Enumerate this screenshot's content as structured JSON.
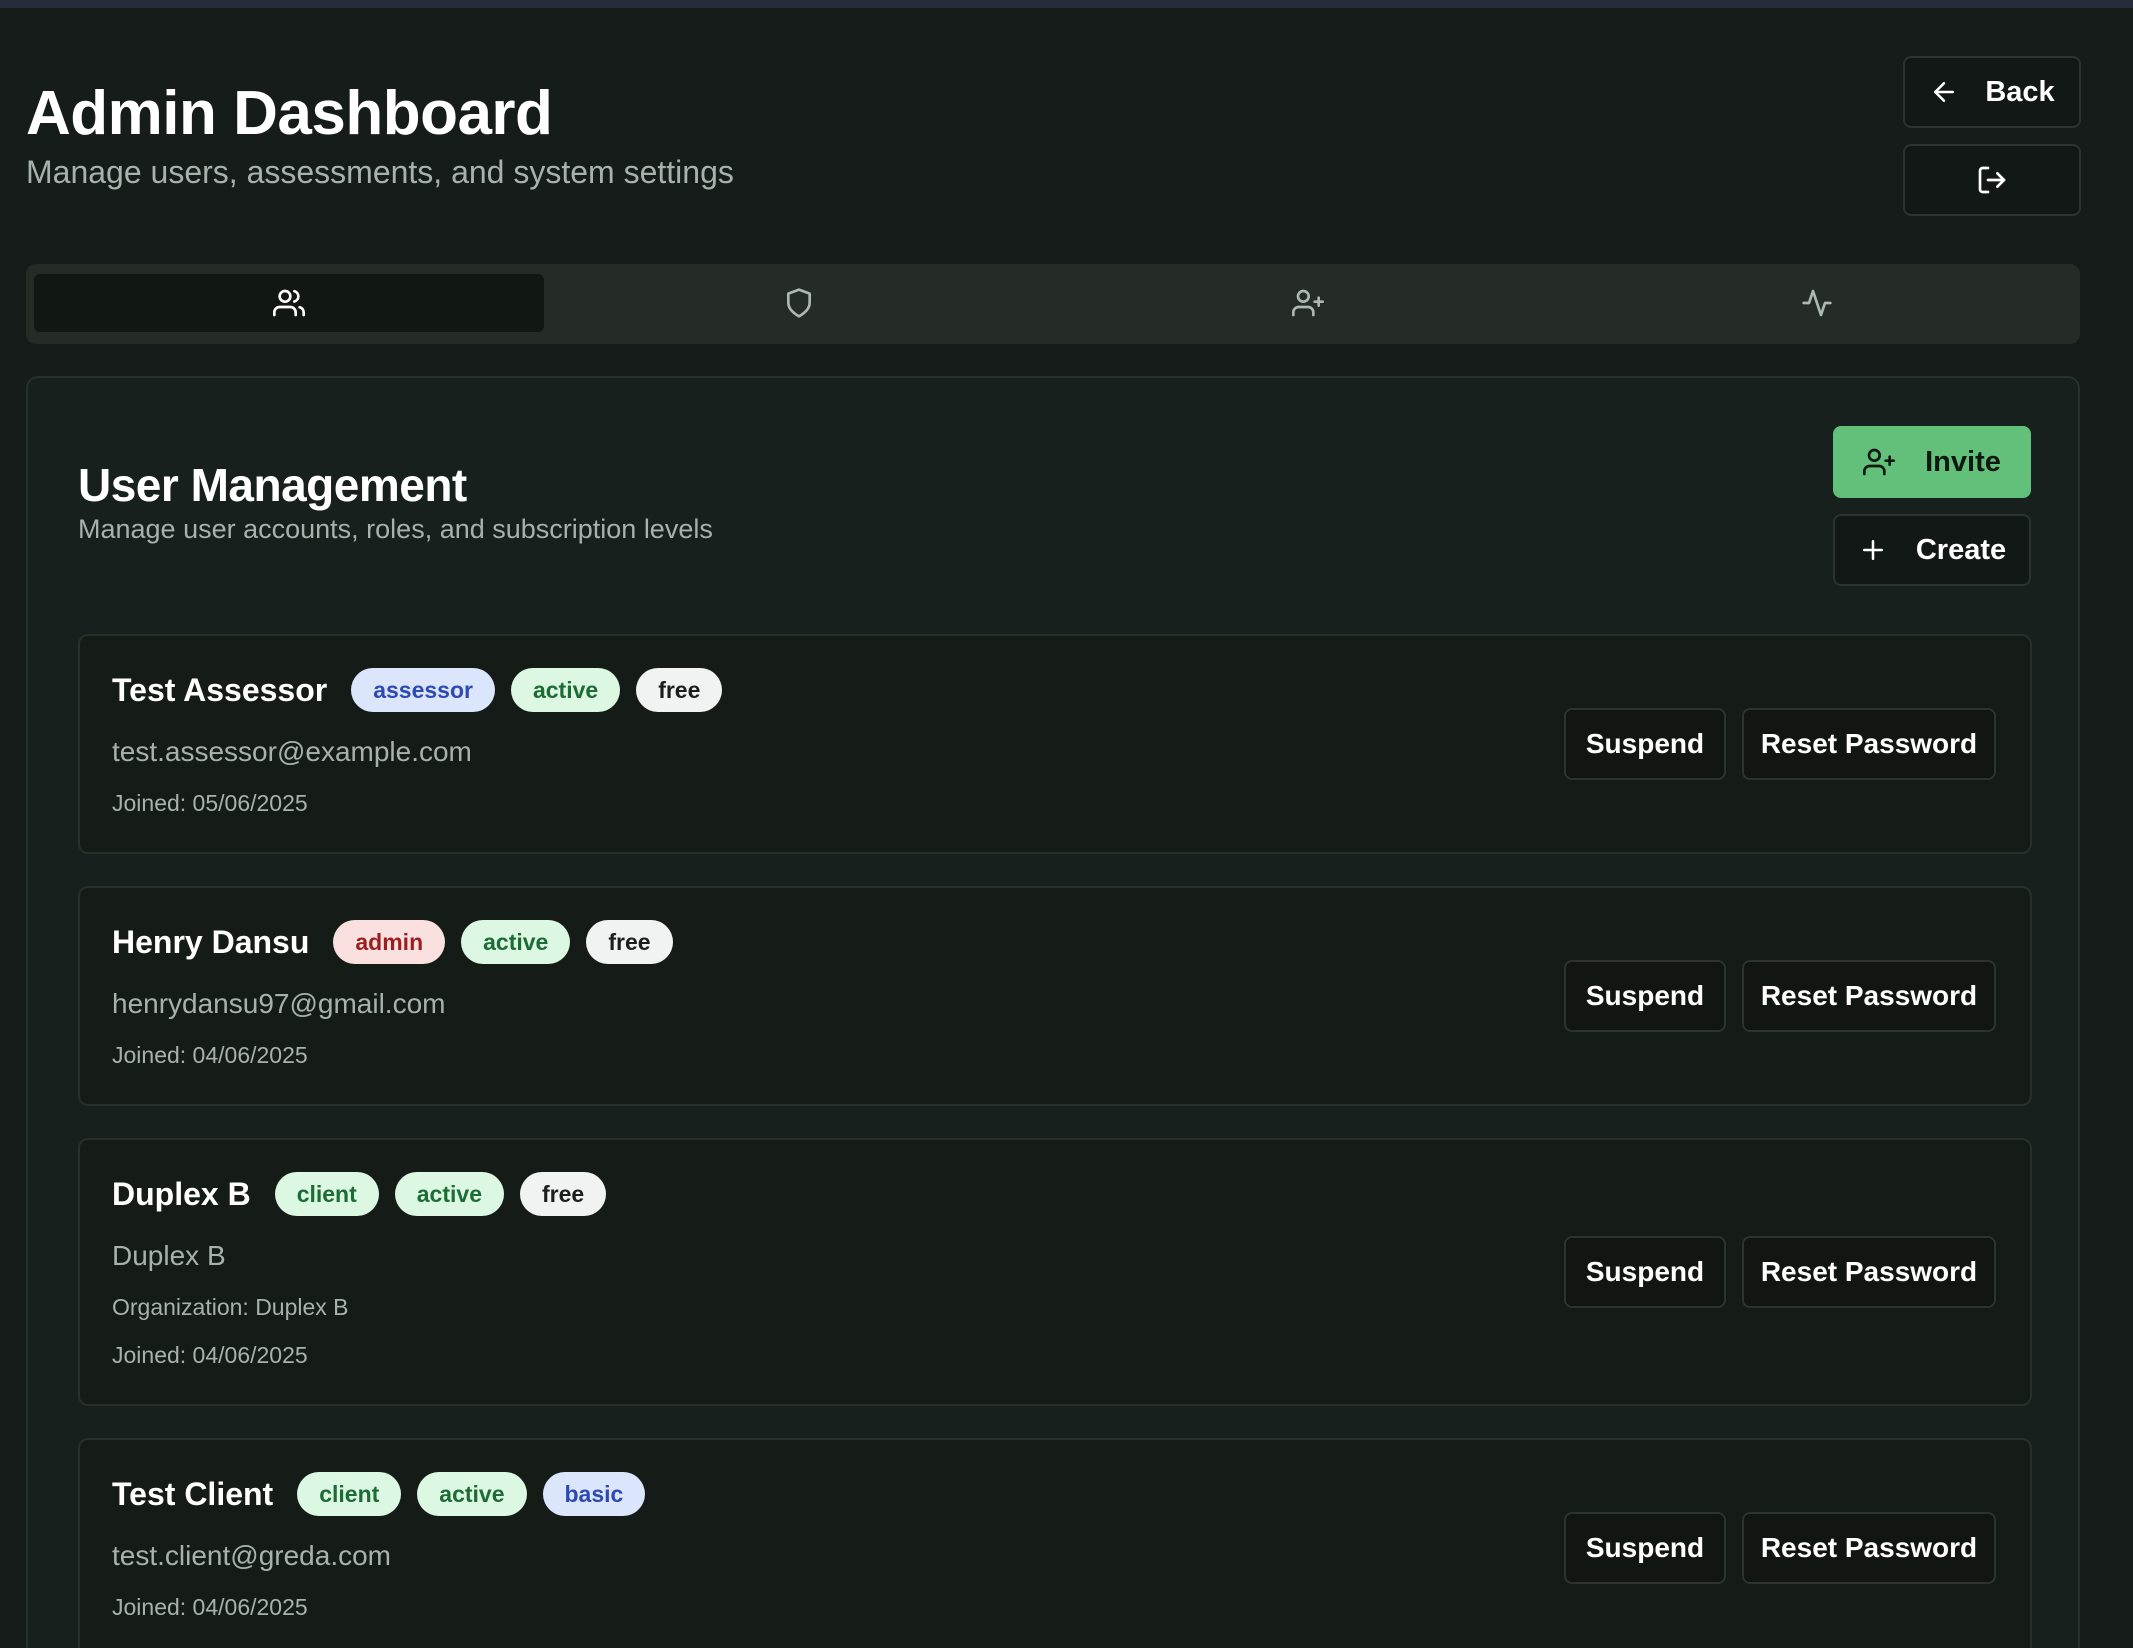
{
  "header": {
    "title": "Admin Dashboard",
    "subtitle": "Manage users, assessments, and system settings",
    "back_label": "Back"
  },
  "tabs": [
    {
      "icon": "users-icon",
      "active": true
    },
    {
      "icon": "shield-icon",
      "active": false
    },
    {
      "icon": "user-plus-icon",
      "active": false
    },
    {
      "icon": "activity-icon",
      "active": false
    }
  ],
  "user_management": {
    "title": "User Management",
    "description": "Manage user accounts, roles, and subscription levels",
    "invite_label": "Invite",
    "create_label": "Create",
    "suspend_label": "Suspend",
    "reset_label": "Reset Password",
    "users": [
      {
        "name": "Test Assessor",
        "role": "assessor",
        "status": "active",
        "plan": "free",
        "email": "test.assessor@example.com",
        "joined": "Joined: 05/06/2025"
      },
      {
        "name": "Henry Dansu",
        "role": "admin",
        "status": "active",
        "plan": "free",
        "email": "henrydansu97@gmail.com",
        "joined": "Joined: 04/06/2025"
      },
      {
        "name": "Duplex B",
        "role": "client",
        "status": "active",
        "plan": "free",
        "email": "Duplex B",
        "organization": "Organization: Duplex B",
        "joined": "Joined: 04/06/2025"
      },
      {
        "name": "Test Client",
        "role": "client",
        "status": "active",
        "plan": "basic",
        "email": "test.client@greda.com",
        "joined": "Joined: 04/06/2025"
      }
    ]
  },
  "colors": {
    "background": "#151c19",
    "accent_green": "#62c07a",
    "badge_blue_bg": "#dbe6fc",
    "badge_green_bg": "#dcf8e3",
    "badge_red_bg": "#fbe0e0"
  }
}
